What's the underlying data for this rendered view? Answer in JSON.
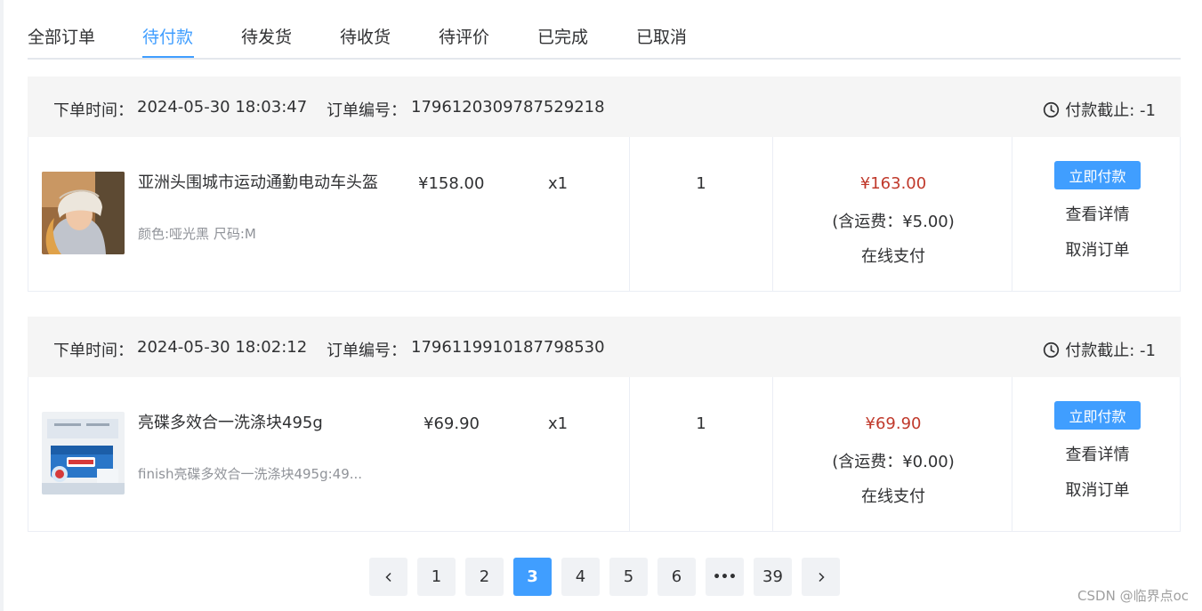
{
  "tabs": [
    {
      "label": "全部订单",
      "active": false
    },
    {
      "label": "待付款",
      "active": true
    },
    {
      "label": "待发货",
      "active": false
    },
    {
      "label": "待收货",
      "active": false
    },
    {
      "label": "待评价",
      "active": false
    },
    {
      "label": "已完成",
      "active": false
    },
    {
      "label": "已取消",
      "active": false
    }
  ],
  "orders": [
    {
      "time_label": "下单时间：",
      "time": "2024-05-30 18:03:47",
      "no_label": "订单编号：",
      "no": "1796120309787529218",
      "deadline": "付款截止: -1",
      "product_name": "亚洲头围城市运动通勤电动车头盔",
      "spec": "颜色:哑光黑 尺码:M",
      "unit_price": "¥158.00",
      "qty": "x1",
      "count": "1",
      "total": "¥163.00",
      "shipping": "(含运费：¥5.00)",
      "pay_method": "在线支付",
      "pay_btn": "立即付款",
      "detail_link": "查看详情",
      "cancel_link": "取消订单"
    },
    {
      "time_label": "下单时间：",
      "time": "2024-05-30 18:02:12",
      "no_label": "订单编号：",
      "no": "1796119910187798530",
      "deadline": "付款截止: -1",
      "product_name": "亮碟多效合一洗涤块495g",
      "spec": "finish亮碟多效合一洗涤块495g:49...",
      "unit_price": "¥69.90",
      "qty": "x1",
      "count": "1",
      "total": "¥69.90",
      "shipping": "(含运费：¥0.00)",
      "pay_method": "在线支付",
      "pay_btn": "立即付款",
      "detail_link": "查看详情",
      "cancel_link": "取消订单"
    }
  ],
  "pagination": {
    "prev": "‹",
    "next": "›",
    "pages": [
      "1",
      "2",
      "3",
      "4",
      "5",
      "6",
      "•••",
      "39"
    ],
    "current": "3"
  },
  "watermark": "CSDN @临界点oc",
  "colors": {
    "accent": "#409eff",
    "price_red": "#c0392b",
    "header_bg": "#f5f5f5"
  }
}
